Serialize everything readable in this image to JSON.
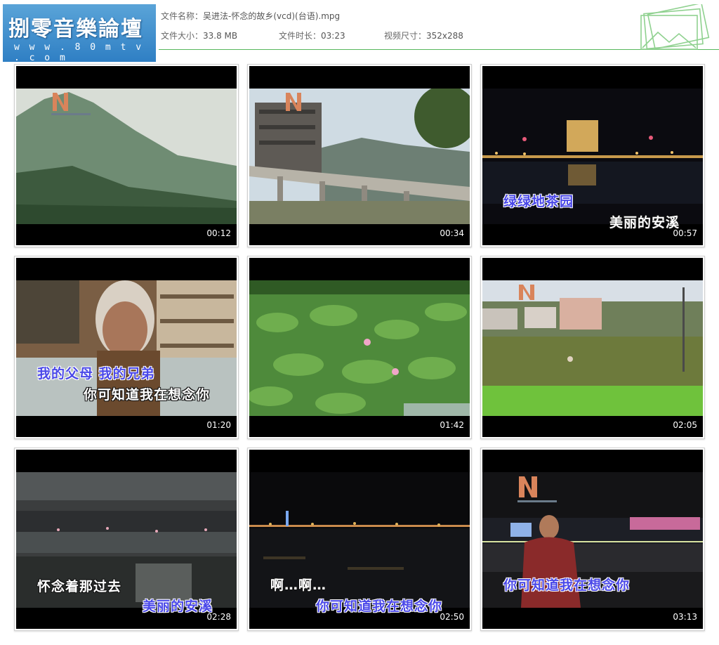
{
  "header": {
    "logo_title": "捌零音樂論壇",
    "logo_url": "w w w . 8 0 m t v . c o m",
    "file_name_key": "文件名称：",
    "file_name": "吴进法-怀念的故乡(vcd)(台语).mpg",
    "file_size_key": "文件大小：",
    "file_size": "33.8 MB",
    "duration_key": "文件时长：",
    "duration": "03:23",
    "resolution_key": "视频尺寸：",
    "resolution": "352x288"
  },
  "thumbnails": [
    {
      "time": "00:12",
      "lyrics": []
    },
    {
      "time": "00:34",
      "lyrics": []
    },
    {
      "time": "00:57",
      "lyrics": [
        "绿绿地茶园",
        "美丽的安溪"
      ]
    },
    {
      "time": "01:20",
      "lyrics": [
        "我的父母  我的兄弟",
        "你可知道我在想念你"
      ]
    },
    {
      "time": "01:42",
      "lyrics": []
    },
    {
      "time": "02:05",
      "lyrics": []
    },
    {
      "time": "02:28",
      "lyrics": [
        "怀念着那过去",
        "美丽的安溪"
      ]
    },
    {
      "time": "02:50",
      "lyrics": [
        "啊…啊…",
        "你可知道我在想念你"
      ]
    },
    {
      "time": "03:13",
      "lyrics": [
        "你可知道我在想念你"
      ]
    }
  ],
  "colors": {
    "logo_bg": "#2f7fc4",
    "divider": "#58b85d",
    "lyric_highlight": "#4a48e8"
  }
}
